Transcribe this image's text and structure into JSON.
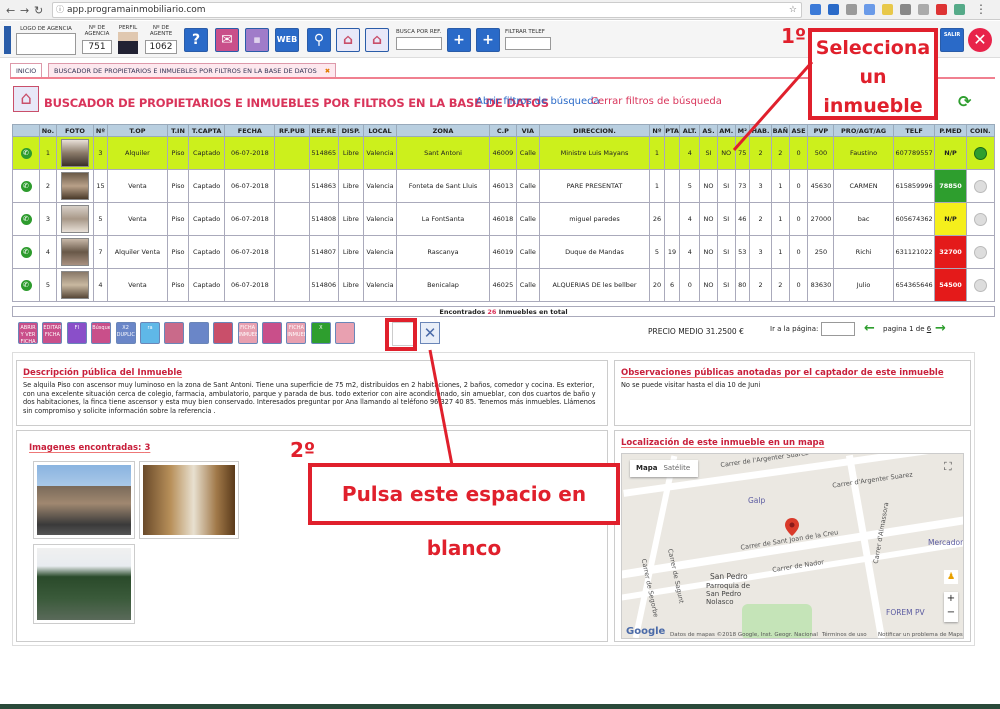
{
  "browser": {
    "url": "app.programainmobiliario.com"
  },
  "toolbar": {
    "logo_label": "LOGO DE AGENCIA",
    "agency_no_label": "Nº DE AGENCIA",
    "agency_no": "751",
    "profile_label": "PERFIL",
    "agent_no_label": "Nº DE AGENTE",
    "agent_no": "1062",
    "search_ref_label": "BUSCA POR REF.",
    "filter_phone_label": "FILTRAR TELEF",
    "web_label": "WEB",
    "exit_label": "SALIR"
  },
  "tabs": [
    {
      "label": "INICIO"
    },
    {
      "label": "BUSCADOR DE PROPIETARIOS E INMUEBLES POR FILTROS EN LA BASE DE DATOS"
    }
  ],
  "header": {
    "title": "BUSCADOR DE PROPIETARIOS E INMUEBLES POR FILTROS EN LA BASE DE DATOS",
    "open_filters": "Abrir filtros de búsqueda",
    "close_filters": "Cerrar filtros de búsqueda"
  },
  "table": {
    "columns": [
      "",
      "No.",
      "FOTO",
      "Nº",
      "T.OP",
      "T.IN",
      "T.CAPTA",
      "FECHA",
      "RF.PUB",
      "REF.RE",
      "DISP.",
      "LOCAL",
      "ZONA",
      "C.P",
      "VIA",
      "DIRECCION.",
      "Nº",
      "PTA",
      "ALT.",
      "AS.",
      "AM.",
      "M²",
      "HAB.",
      "BAÑ",
      "ASE",
      "PVP",
      "PRO/AGT/AG",
      "TELF",
      "P.MED",
      "COIN."
    ],
    "rows": [
      {
        "no": "1",
        "num": "3",
        "top": "Alquiler",
        "tin": "Piso",
        "capta": "Captado",
        "fecha": "06-07-2018",
        "rfpub": "",
        "ref": "514865",
        "disp": "Libre",
        "local": "Valencia",
        "zona": "Sant Antoni",
        "cp": "46009",
        "via": "Calle",
        "dir": "Ministre Luis Mayans",
        "n": "1",
        "pta": "",
        "alt": "4",
        "as": "SI",
        "am": "NO",
        "m2": "75",
        "hab": "2",
        "ban": "2",
        "ase": "0",
        "pvp": "500",
        "agt": "Faustino",
        "telf": "607789557",
        "pmed": "N/P",
        "pmed_color": "#ccf01c",
        "selected": true
      },
      {
        "no": "2",
        "num": "15",
        "top": "Venta",
        "tin": "Piso",
        "capta": "Captado",
        "fecha": "06-07-2018",
        "rfpub": "",
        "ref": "514863",
        "disp": "Libre",
        "local": "Valencia",
        "zona": "Fonteta de Sant Lluis",
        "cp": "46013",
        "via": "Calle",
        "dir": "PARE PRESENTAT",
        "n": "1",
        "pta": "",
        "alt": "5",
        "as": "NO",
        "am": "SI",
        "m2": "73",
        "hab": "3",
        "ban": "1",
        "ase": "0",
        "pvp": "45630",
        "agt": "CARMEN",
        "telf": "615859996",
        "pmed": "78850",
        "pmed_color": "#2e9e2e",
        "selected": false
      },
      {
        "no": "3",
        "num": "5",
        "top": "Venta",
        "tin": "Piso",
        "capta": "Captado",
        "fecha": "06-07-2018",
        "rfpub": "",
        "ref": "514808",
        "disp": "Libre",
        "local": "Valencia",
        "zona": "La FontSanta",
        "cp": "46018",
        "via": "Calle",
        "dir": "miguel paredes",
        "n": "26",
        "pta": "",
        "alt": "4",
        "as": "NO",
        "am": "SI",
        "m2": "46",
        "hab": "2",
        "ban": "1",
        "ase": "0",
        "pvp": "27000",
        "agt": "bac",
        "telf": "605674362",
        "pmed": "N/P",
        "pmed_color": "#f5ef1c",
        "selected": false
      },
      {
        "no": "4",
        "num": "7",
        "top": "Alquiler Venta",
        "tin": "Piso",
        "capta": "Captado",
        "fecha": "06-07-2018",
        "rfpub": "",
        "ref": "514807",
        "disp": "Libre",
        "local": "Valencia",
        "zona": "Rascanya",
        "cp": "46019",
        "via": "Calle",
        "dir": "Duque de Mandas",
        "n": "5",
        "pta": "19",
        "alt": "4",
        "as": "NO",
        "am": "SI",
        "m2": "53",
        "hab": "3",
        "ban": "1",
        "ase": "0",
        "pvp": "250",
        "agt": "Richi",
        "telf": "631121022",
        "pmed": "32700",
        "pmed_color": "#e41a1a",
        "selected": false
      },
      {
        "no": "5",
        "num": "4",
        "top": "Venta",
        "tin": "Piso",
        "capta": "Captado",
        "fecha": "06-07-2018",
        "rfpub": "",
        "ref": "514806",
        "disp": "Libre",
        "local": "Valencia",
        "zona": "Benicalap",
        "cp": "46025",
        "via": "Calle",
        "dir": "ALQUERIAS DE les bellber",
        "n": "20",
        "pta": "6",
        "alt": "0",
        "as": "NO",
        "am": "SI",
        "m2": "80",
        "hab": "2",
        "ban": "2",
        "ase": "0",
        "pvp": "83630",
        "agt": "Julio",
        "telf": "654365646",
        "pmed": "54500",
        "pmed_color": "#e41a1a",
        "selected": false
      }
    ],
    "found_prefix": "Encontrados",
    "found_count": "26",
    "found_suffix": "Inmuebles en total"
  },
  "pagination": {
    "avg_price": "PRECIO MEDIO 31.2500 €",
    "goto_label": "Ir a la página:",
    "page_prefix": "pagina 1 de",
    "page_total": "6"
  },
  "actions": [
    {
      "name": "abrir-ver-ficha",
      "label": "ABRIR Y VER FICHA",
      "color": "#c94f8a"
    },
    {
      "name": "editar-ficha",
      "label": "EDITAR FICHA",
      "color": "#c94f8a"
    },
    {
      "name": "ficha",
      "label": "FI",
      "color": "#8a4fc9"
    },
    {
      "name": "busqueda",
      "label": "Búsqueda",
      "color": "#c94f8a"
    },
    {
      "name": "duplicar",
      "label": "X2 DUPLICAR",
      "color": "#6a86c8"
    },
    {
      "name": "ra",
      "label": "ra",
      "color": "#5fb8e8"
    },
    {
      "name": "inmuebles",
      "label": "",
      "color": "#c96a8a"
    },
    {
      "name": "enviar",
      "label": "",
      "color": "#6a86c8"
    },
    {
      "name": "imprimir",
      "label": "",
      "color": "#c94f6a"
    },
    {
      "name": "ficha-inmueble",
      "label": "FICHA INMUEBLE",
      "color": "#e8a0b0"
    },
    {
      "name": "fotos",
      "label": "",
      "color": "#c94f8a"
    },
    {
      "name": "ficha-inmueble-2",
      "label": "FICHA INMUEBLE",
      "color": "#e8a0b0"
    },
    {
      "name": "excel",
      "label": "X",
      "color": "#2e9e2e"
    },
    {
      "name": "localizar",
      "label": "",
      "color": "#e8a0b0"
    }
  ],
  "description": {
    "title": "Descripción pública del Inmueble",
    "text": "Se alquila Piso con ascensor muy luminoso en la zona de Sant Antoni. Tiene una superficie de 75 m2, distribuidos en 2 habitaciones, 2 baños, comedor y cocina. Es exterior, con una excelente situación cerca de colegio, farmacia, ambulatorio, parque y parada de bus. todo exterior con aire acondicionado, sin amueblar, con dos cuartos de baño y dos habitaciones, la finca tiene ascensor y esta muy bien conservado. Interesados preguntar por Ana llamando al teléfono 96 327 40 85. Tenemos más inmuebles. Llámenos sin compromiso y solicite información sobre la referencia ."
  },
  "observations": {
    "title": "Observaciones públicas anotadas por el captador de este inmueble",
    "text": "No se puede visitar hasta el dia 10 de Juni"
  },
  "images": {
    "title_prefix": "Imagenes encontradas:",
    "count": "3"
  },
  "map": {
    "title": "Localización de este inmueble en un mapa",
    "map_btn": "Mapa",
    "sat_btn": "Satélite",
    "streets": [
      "Carrer de l'Argenter Suárez",
      "Carrer d'Argenter Suarez",
      "Carrer de Sant Joan de la Creu",
      "Carrer de Nador",
      "Carrer d'Almassora",
      "Carrer de Segorbe",
      "Carrer de Sagunt"
    ],
    "places": [
      "Galp",
      "Mercadona",
      "San Pedro",
      "Parroquia de San Pedro Nolasco",
      "FOREM PV"
    ],
    "google": "Google",
    "footer": "Datos de mapas ©2018 Google, Inst. Geogr. Nacional",
    "terms": "Términos de uso",
    "report": "Notificar un problema de Maps"
  },
  "annotations": {
    "step1": "1º",
    "step1_text_1": "Selecciona",
    "step1_text_2": "un",
    "step1_text_3": "inmueble",
    "step2": "2º",
    "step2_text": "Pulsa este espacio en blanco"
  }
}
